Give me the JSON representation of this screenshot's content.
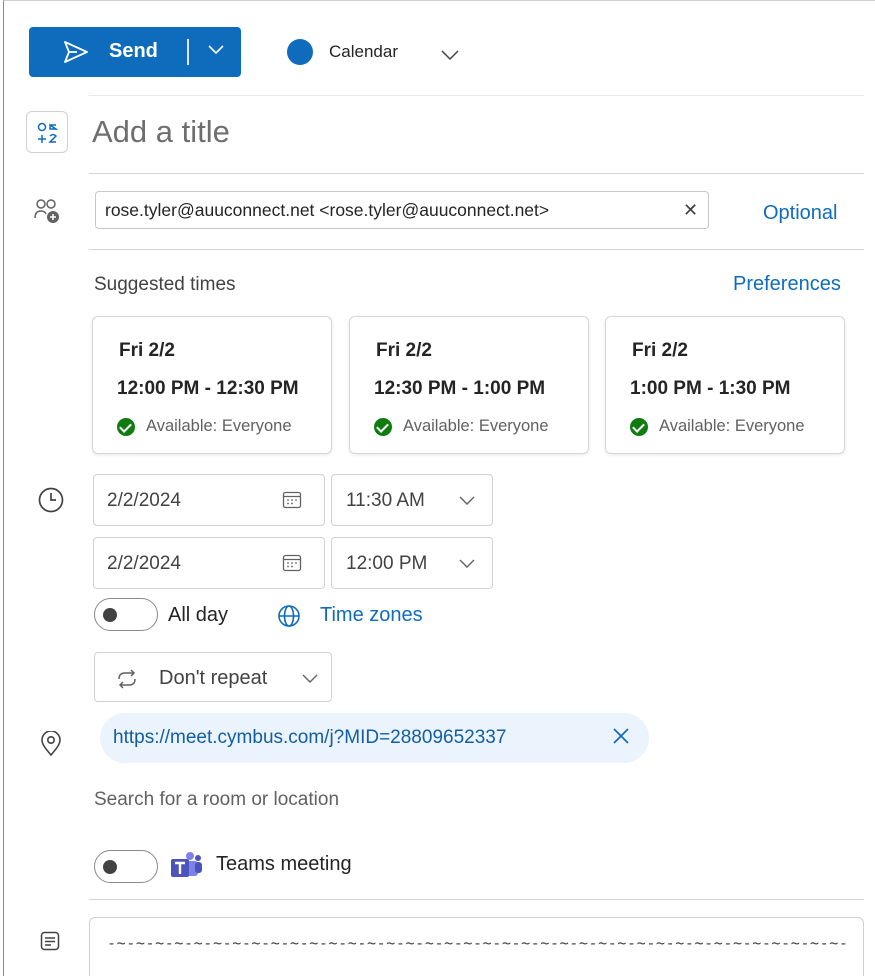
{
  "toolbar": {
    "send_label": "Send",
    "calendar_label": "Calendar",
    "calendar_color": "#0f6cbd"
  },
  "title": {
    "placeholder": "Add a title"
  },
  "attendees": {
    "chip_text": "rose.tyler@auuconnect.net <rose.tyler@auuconnect.net>",
    "optional_label": "Optional"
  },
  "suggested": {
    "label": "Suggested times",
    "preferences_label": "Preferences",
    "cards": [
      {
        "date": "Fri 2/2",
        "range": "12:00 PM - 12:30 PM",
        "availability": "Available: Everyone"
      },
      {
        "date": "Fri 2/2",
        "range": "12:30 PM - 1:00 PM",
        "availability": "Available: Everyone"
      },
      {
        "date": "Fri 2/2",
        "range": "1:00 PM - 1:30 PM",
        "availability": "Available: Everyone"
      }
    ]
  },
  "schedule": {
    "start_date": "2/2/2024",
    "start_time": "11:30 AM",
    "end_date": "2/2/2024",
    "end_time": "12:00 PM",
    "all_day_label": "All day",
    "all_day_on": false,
    "time_zones_label": "Time zones",
    "repeat_label": "Don't repeat"
  },
  "location": {
    "url": "https://meet.cymbus.com/j?MID=28809652337",
    "search_placeholder": "Search for a room or location"
  },
  "teams": {
    "label": "Teams meeting",
    "on": false
  },
  "body": {
    "signature_line": "-~-~-~-~-~-~-~-~-~-~-~-~-~-~-~-~-~-~-~-~-~-~-~-~-~-~-~-~-~-~-~-~-~-~-~-~-~-~-"
  }
}
